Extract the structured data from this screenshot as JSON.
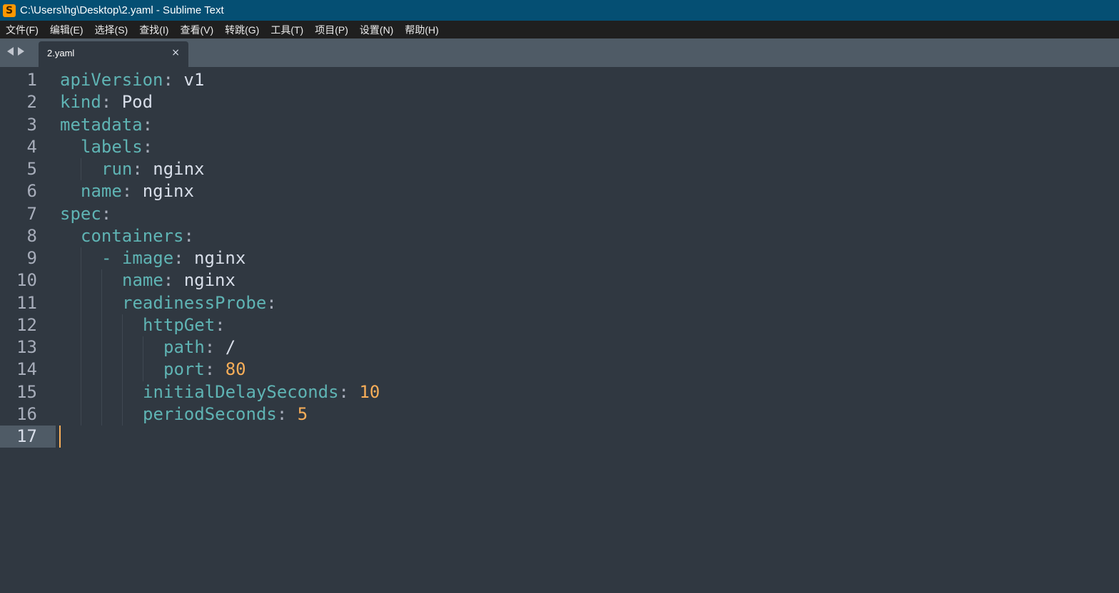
{
  "window": {
    "title": "C:\\Users\\hg\\Desktop\\2.yaml - Sublime Text",
    "icon": "sublime-logo"
  },
  "menu": [
    {
      "label": "文件(F)"
    },
    {
      "label": "编辑(E)"
    },
    {
      "label": "选择(S)"
    },
    {
      "label": "查找(I)"
    },
    {
      "label": "查看(V)"
    },
    {
      "label": "转跳(G)"
    },
    {
      "label": "工具(T)"
    },
    {
      "label": "项目(P)"
    },
    {
      "label": "设置(N)"
    },
    {
      "label": "帮助(H)"
    }
  ],
  "tabs": [
    {
      "label": "2.yaml",
      "close": "×",
      "active": true
    }
  ],
  "editor": {
    "active_line": 17,
    "lines": [
      {
        "n": "1",
        "indent": 0,
        "key": "apiVersion",
        "sep": ":",
        "val": " v1",
        "num": ""
      },
      {
        "n": "2",
        "indent": 0,
        "key": "kind",
        "sep": ":",
        "val": " Pod",
        "num": ""
      },
      {
        "n": "3",
        "indent": 0,
        "key": "metadata",
        "sep": ":",
        "val": "",
        "num": ""
      },
      {
        "n": "4",
        "indent": 1,
        "key": "labels",
        "sep": ":",
        "val": "",
        "num": ""
      },
      {
        "n": "5",
        "indent": 2,
        "key": "run",
        "sep": ":",
        "val": " nginx",
        "num": ""
      },
      {
        "n": "6",
        "indent": 1,
        "key": "name",
        "sep": ":",
        "val": " nginx",
        "num": ""
      },
      {
        "n": "7",
        "indent": 0,
        "key": "spec",
        "sep": ":",
        "val": "",
        "num": ""
      },
      {
        "n": "8",
        "indent": 1,
        "key": "containers",
        "sep": ":",
        "val": "",
        "num": ""
      },
      {
        "n": "9",
        "indent": 2,
        "dash": "- ",
        "key": "image",
        "sep": ":",
        "val": " nginx",
        "num": ""
      },
      {
        "n": "10",
        "indent": 3,
        "key": "name",
        "sep": ":",
        "val": " nginx",
        "num": ""
      },
      {
        "n": "11",
        "indent": 3,
        "key": "readinessProbe",
        "sep": ":",
        "val": "",
        "num": ""
      },
      {
        "n": "12",
        "indent": 4,
        "key": "httpGet",
        "sep": ":",
        "val": "",
        "num": ""
      },
      {
        "n": "13",
        "indent": 5,
        "key": "path",
        "sep": ":",
        "val": " /",
        "num": ""
      },
      {
        "n": "14",
        "indent": 5,
        "key": "port",
        "sep": ":",
        "val": "",
        "num": " 80"
      },
      {
        "n": "15",
        "indent": 4,
        "key": "initialDelaySeconds",
        "sep": ":",
        "val": "",
        "num": " 10"
      },
      {
        "n": "16",
        "indent": 4,
        "key": "periodSeconds",
        "sep": ":",
        "val": "",
        "num": " 5"
      },
      {
        "n": "17",
        "indent": 0,
        "key": "",
        "sep": "",
        "val": "",
        "num": ""
      }
    ]
  },
  "colors": {
    "key": "#5fb4b4",
    "value": "#d8dee9",
    "number": "#f9ae58",
    "background": "#303841",
    "titlebar": "#054f73"
  }
}
